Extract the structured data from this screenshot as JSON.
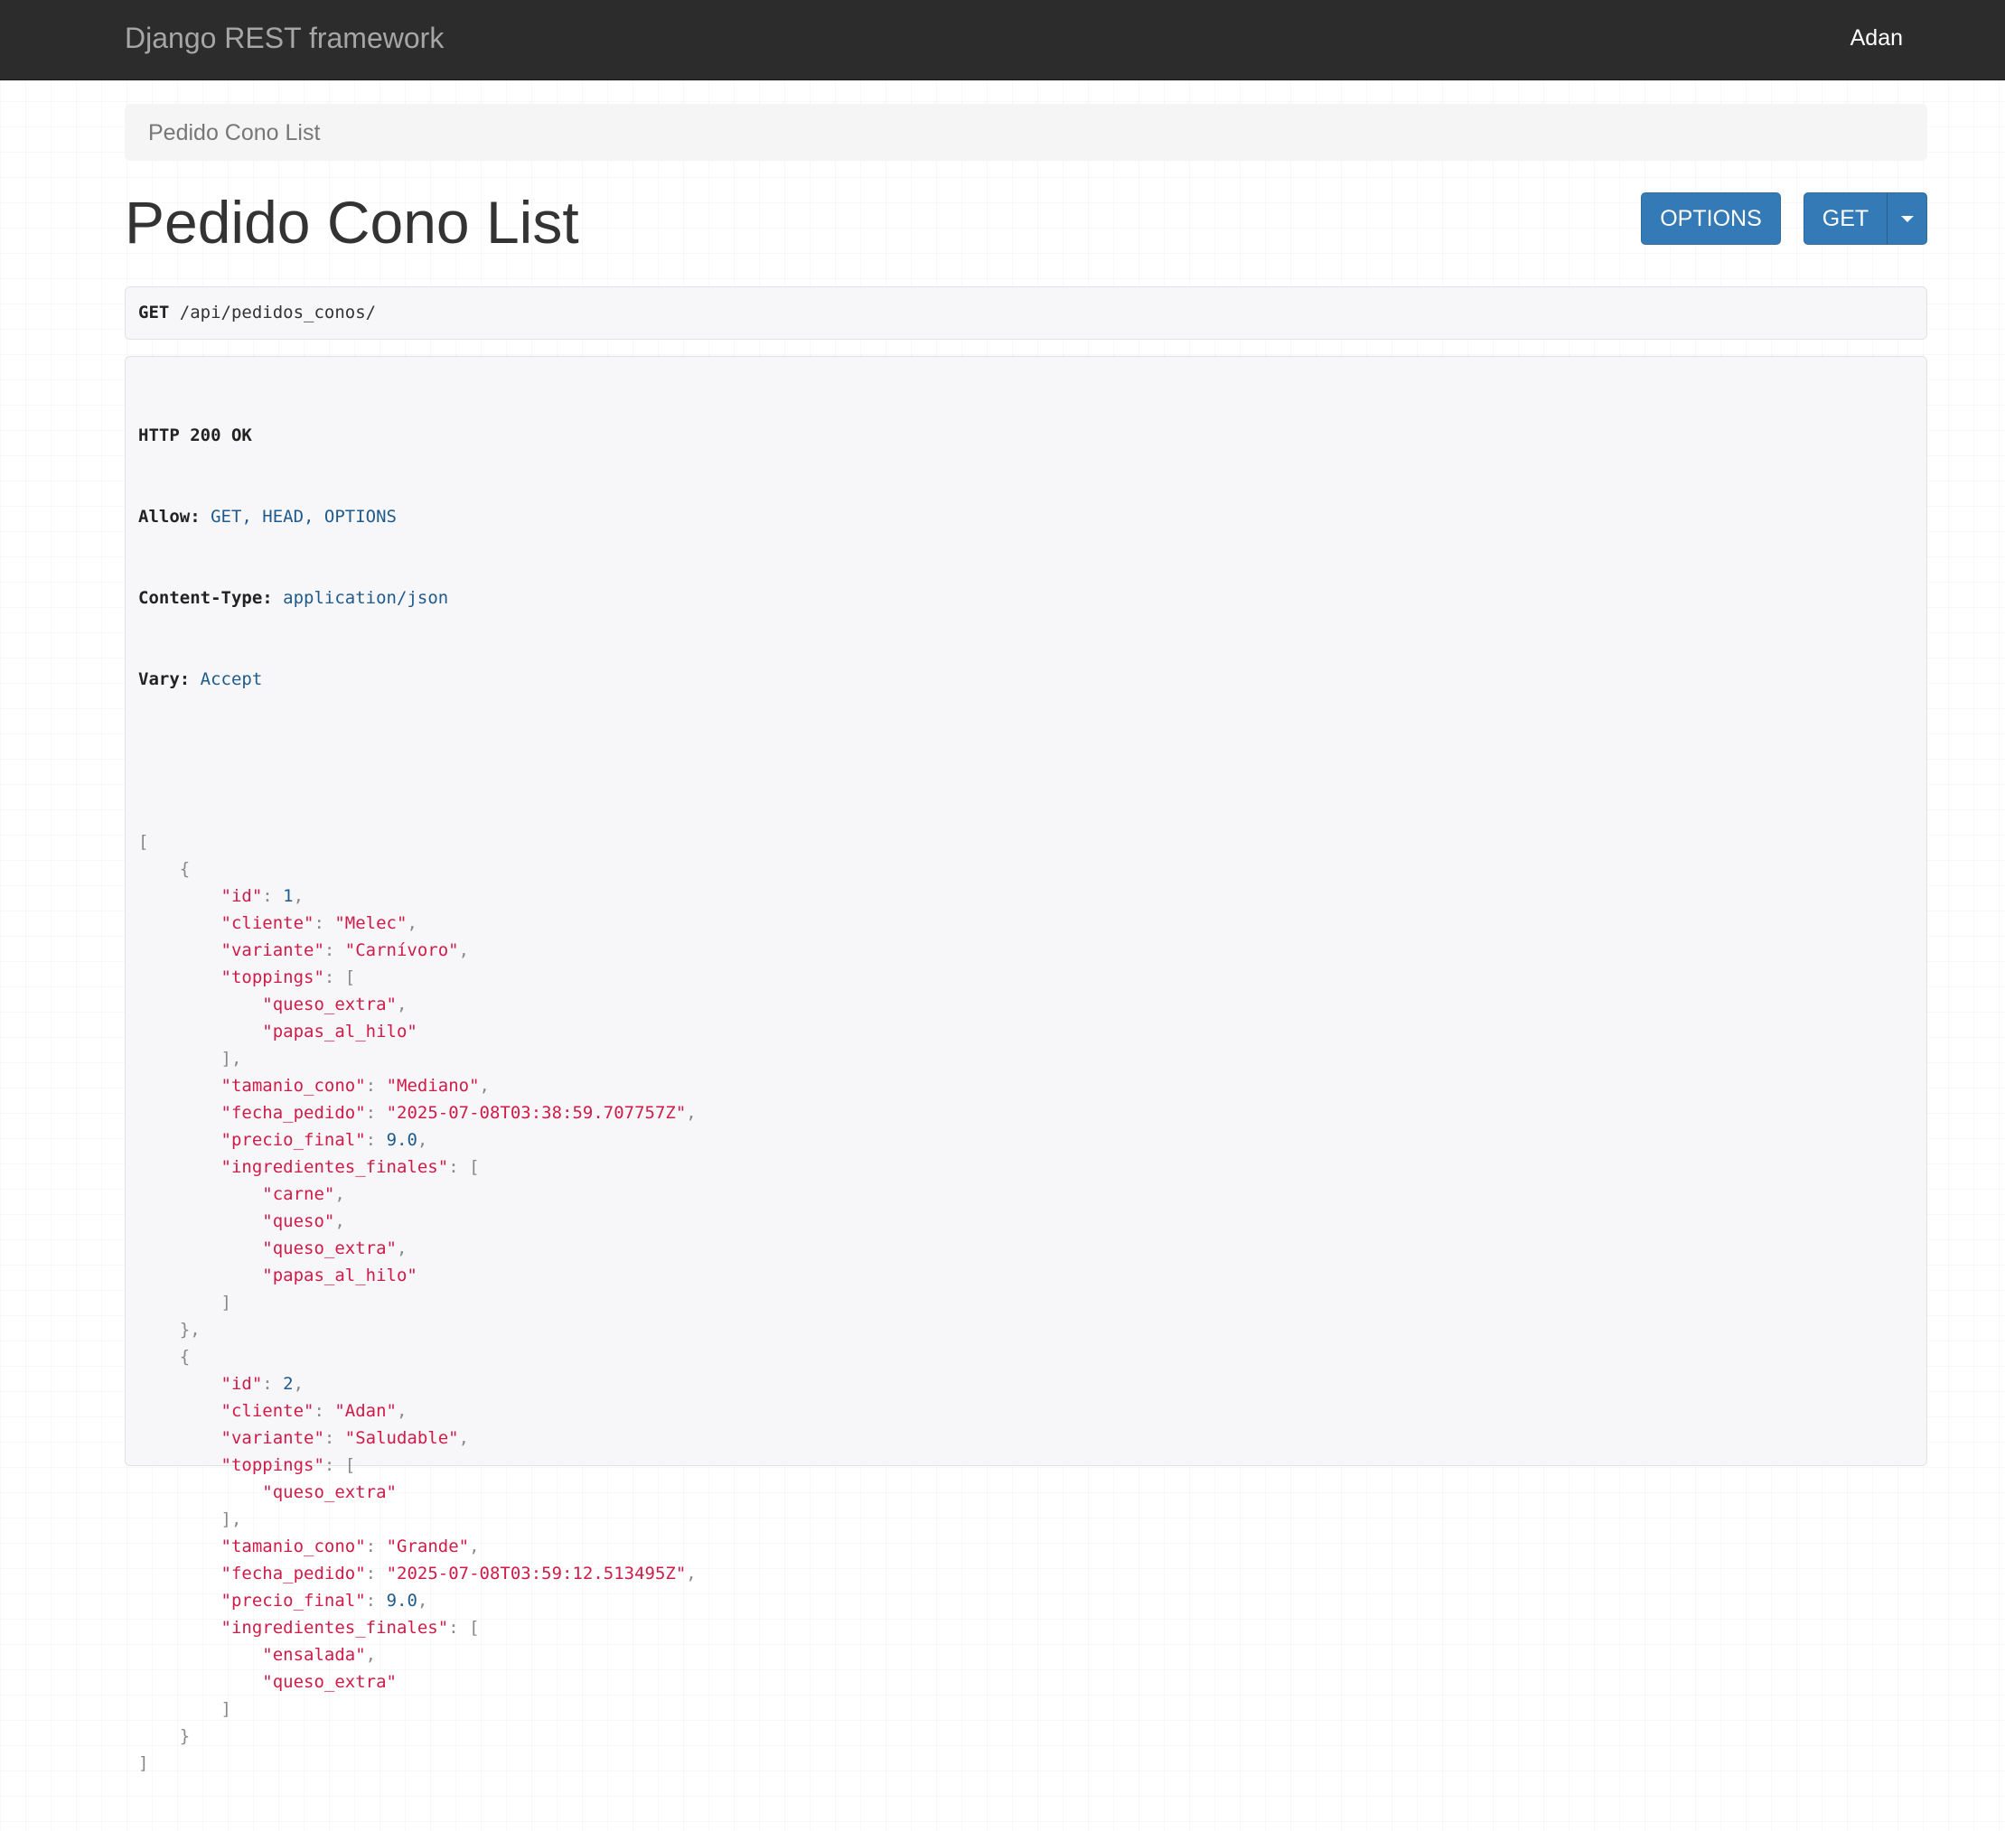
{
  "navbar": {
    "brand": "Django REST framework",
    "user": "Adan"
  },
  "breadcrumb": {
    "items": [
      "Pedido Cono List"
    ]
  },
  "page": {
    "title": "Pedido Cono List"
  },
  "actions": {
    "options_label": "OPTIONS",
    "get_label": "GET"
  },
  "request": {
    "method": "GET",
    "path": "/api/pedidos_conos/"
  },
  "response": {
    "status": "HTTP 200 OK",
    "headers": [
      {
        "name": "Allow:",
        "value": "GET, HEAD, OPTIONS"
      },
      {
        "name": "Content-Type:",
        "value": "application/json"
      },
      {
        "name": "Vary:",
        "value": "Accept"
      }
    ],
    "lines": [
      [
        {
          "t": "[",
          "c": "p"
        }
      ],
      [
        {
          "t": "    {",
          "c": "p"
        }
      ],
      [
        {
          "t": "        "
        },
        {
          "t": "\"id\"",
          "c": "k"
        },
        {
          "t": ": ",
          "c": "p"
        },
        {
          "t": "1",
          "c": "n"
        },
        {
          "t": ",",
          "c": "p"
        }
      ],
      [
        {
          "t": "        "
        },
        {
          "t": "\"cliente\"",
          "c": "k"
        },
        {
          "t": ": ",
          "c": "p"
        },
        {
          "t": "\"Melec\"",
          "c": "s"
        },
        {
          "t": ",",
          "c": "p"
        }
      ],
      [
        {
          "t": "        "
        },
        {
          "t": "\"variante\"",
          "c": "k"
        },
        {
          "t": ": ",
          "c": "p"
        },
        {
          "t": "\"Carnívoro\"",
          "c": "s"
        },
        {
          "t": ",",
          "c": "p"
        }
      ],
      [
        {
          "t": "        "
        },
        {
          "t": "\"toppings\"",
          "c": "k"
        },
        {
          "t": ": [",
          "c": "p"
        }
      ],
      [
        {
          "t": "            "
        },
        {
          "t": "\"queso_extra\"",
          "c": "s"
        },
        {
          "t": ",",
          "c": "p"
        }
      ],
      [
        {
          "t": "            "
        },
        {
          "t": "\"papas_al_hilo\"",
          "c": "s"
        }
      ],
      [
        {
          "t": "        ],",
          "c": "p"
        }
      ],
      [
        {
          "t": "        "
        },
        {
          "t": "\"tamanio_cono\"",
          "c": "k"
        },
        {
          "t": ": ",
          "c": "p"
        },
        {
          "t": "\"Mediano\"",
          "c": "s"
        },
        {
          "t": ",",
          "c": "p"
        }
      ],
      [
        {
          "t": "        "
        },
        {
          "t": "\"fecha_pedido\"",
          "c": "k"
        },
        {
          "t": ": ",
          "c": "p"
        },
        {
          "t": "\"2025-07-08T03:38:59.707757Z\"",
          "c": "s"
        },
        {
          "t": ",",
          "c": "p"
        }
      ],
      [
        {
          "t": "        "
        },
        {
          "t": "\"precio_final\"",
          "c": "k"
        },
        {
          "t": ": ",
          "c": "p"
        },
        {
          "t": "9.0",
          "c": "n"
        },
        {
          "t": ",",
          "c": "p"
        }
      ],
      [
        {
          "t": "        "
        },
        {
          "t": "\"ingredientes_finales\"",
          "c": "k"
        },
        {
          "t": ": [",
          "c": "p"
        }
      ],
      [
        {
          "t": "            "
        },
        {
          "t": "\"carne\"",
          "c": "s"
        },
        {
          "t": ",",
          "c": "p"
        }
      ],
      [
        {
          "t": "            "
        },
        {
          "t": "\"queso\"",
          "c": "s"
        },
        {
          "t": ",",
          "c": "p"
        }
      ],
      [
        {
          "t": "            "
        },
        {
          "t": "\"queso_extra\"",
          "c": "s"
        },
        {
          "t": ",",
          "c": "p"
        }
      ],
      [
        {
          "t": "            "
        },
        {
          "t": "\"papas_al_hilo\"",
          "c": "s"
        }
      ],
      [
        {
          "t": "        ]",
          "c": "p"
        }
      ],
      [
        {
          "t": "    },",
          "c": "p"
        }
      ],
      [
        {
          "t": "    {",
          "c": "p"
        }
      ],
      [
        {
          "t": "        "
        },
        {
          "t": "\"id\"",
          "c": "k"
        },
        {
          "t": ": ",
          "c": "p"
        },
        {
          "t": "2",
          "c": "n"
        },
        {
          "t": ",",
          "c": "p"
        }
      ],
      [
        {
          "t": "        "
        },
        {
          "t": "\"cliente\"",
          "c": "k"
        },
        {
          "t": ": ",
          "c": "p"
        },
        {
          "t": "\"Adan\"",
          "c": "s"
        },
        {
          "t": ",",
          "c": "p"
        }
      ],
      [
        {
          "t": "        "
        },
        {
          "t": "\"variante\"",
          "c": "k"
        },
        {
          "t": ": ",
          "c": "p"
        },
        {
          "t": "\"Saludable\"",
          "c": "s"
        },
        {
          "t": ",",
          "c": "p"
        }
      ],
      [
        {
          "t": "        "
        },
        {
          "t": "\"toppings\"",
          "c": "k"
        },
        {
          "t": ": [",
          "c": "p"
        }
      ],
      [
        {
          "t": "            "
        },
        {
          "t": "\"queso_extra\"",
          "c": "s"
        }
      ],
      [
        {
          "t": "        ],",
          "c": "p"
        }
      ],
      [
        {
          "t": "        "
        },
        {
          "t": "\"tamanio_cono\"",
          "c": "k"
        },
        {
          "t": ": ",
          "c": "p"
        },
        {
          "t": "\"Grande\"",
          "c": "s"
        },
        {
          "t": ",",
          "c": "p"
        }
      ],
      [
        {
          "t": "        "
        },
        {
          "t": "\"fecha_pedido\"",
          "c": "k"
        },
        {
          "t": ": ",
          "c": "p"
        },
        {
          "t": "\"2025-07-08T03:59:12.513495Z\"",
          "c": "s"
        },
        {
          "t": ",",
          "c": "p"
        }
      ],
      [
        {
          "t": "        "
        },
        {
          "t": "\"precio_final\"",
          "c": "k"
        },
        {
          "t": ": ",
          "c": "p"
        },
        {
          "t": "9.0",
          "c": "n"
        },
        {
          "t": ",",
          "c": "p"
        }
      ],
      [
        {
          "t": "        "
        },
        {
          "t": "\"ingredientes_finales\"",
          "c": "k"
        },
        {
          "t": ": [",
          "c": "p"
        }
      ],
      [
        {
          "t": "            "
        },
        {
          "t": "\"ensalada\"",
          "c": "s"
        },
        {
          "t": ",",
          "c": "p"
        }
      ],
      [
        {
          "t": "            "
        },
        {
          "t": "\"queso_extra\"",
          "c": "s"
        }
      ],
      [
        {
          "t": "        ]",
          "c": "p"
        }
      ],
      [
        {
          "t": "    }",
          "c": "p"
        }
      ],
      [
        {
          "t": "]",
          "c": "p"
        }
      ]
    ]
  },
  "colors": {
    "navbar_bg": "#2c2c2c",
    "primary_button": "#337ab7",
    "json_key": "#d01b48",
    "json_string": "#d01b48",
    "json_number": "#1f5a8c",
    "header_value": "#1f5a8c"
  }
}
